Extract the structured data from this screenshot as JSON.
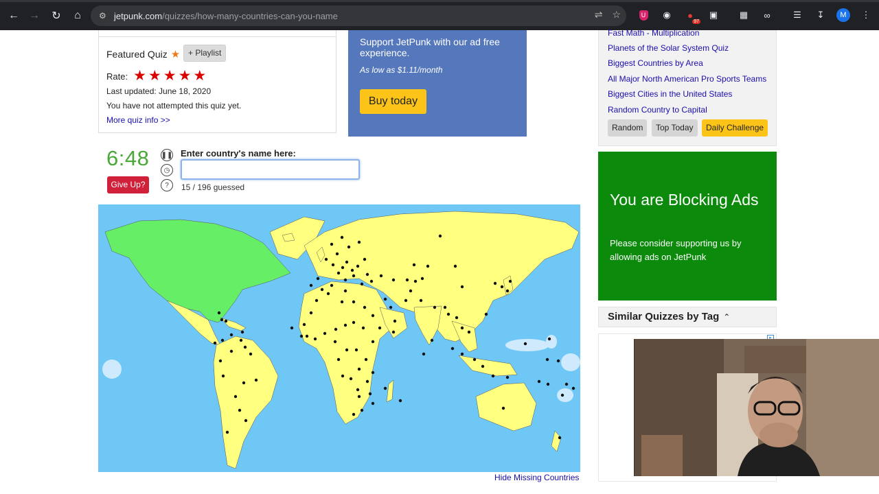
{
  "browser": {
    "url_host": "jetpunk.com",
    "url_path": "/quizzes/how-many-countries-can-you-name",
    "avatar_letter": "M",
    "ext_badge": "97"
  },
  "quiz_info": {
    "featured_label": "Featured Quiz",
    "playlist_label": "+ Playlist",
    "rate_label": "Rate:",
    "rating_stars": 5,
    "last_updated": "Last updated: June 18, 2020",
    "attempt_status": "You have not attempted this quiz yet.",
    "more_info_link": "More quiz info >>"
  },
  "support_ad": {
    "text": "Support JetPunk with our ad free experience.",
    "price": "As low as $1.11/month",
    "button": "Buy today"
  },
  "quiz": {
    "timer": "6:48",
    "give_up": "Give Up?",
    "input_label": "Enter country's name here:",
    "input_value": "",
    "guessed": "15 / 196 guessed",
    "hide_missing": "Hide Missing Countries"
  },
  "sidebar": {
    "links": [
      "Fast Math - Multiplication",
      "Planets of the Solar System Quiz",
      "Biggest Countries by Area",
      "All Major North American Pro Sports Teams",
      "Biggest Cities in the United States",
      "Random Country to Capital"
    ],
    "buttons": [
      "Random",
      "Top Today",
      "Daily Challenge"
    ]
  },
  "blocking_ad": {
    "heading": "You are Blocking Ads",
    "text": "Please consider supporting us by allowing ads on JetPunk"
  },
  "similar": {
    "heading": "Similar Quizzes by Tag"
  },
  "colors": {
    "ocean": "#6fc7f6",
    "land_unguessed": "#ffff80",
    "land_guessed": "#66ee66",
    "timer_green": "#4aa838",
    "give_up_red": "#d0203a",
    "ad_blue": "#5577bb",
    "blocking_green": "#0b8a0b",
    "button_yellow": "#fcc419"
  }
}
